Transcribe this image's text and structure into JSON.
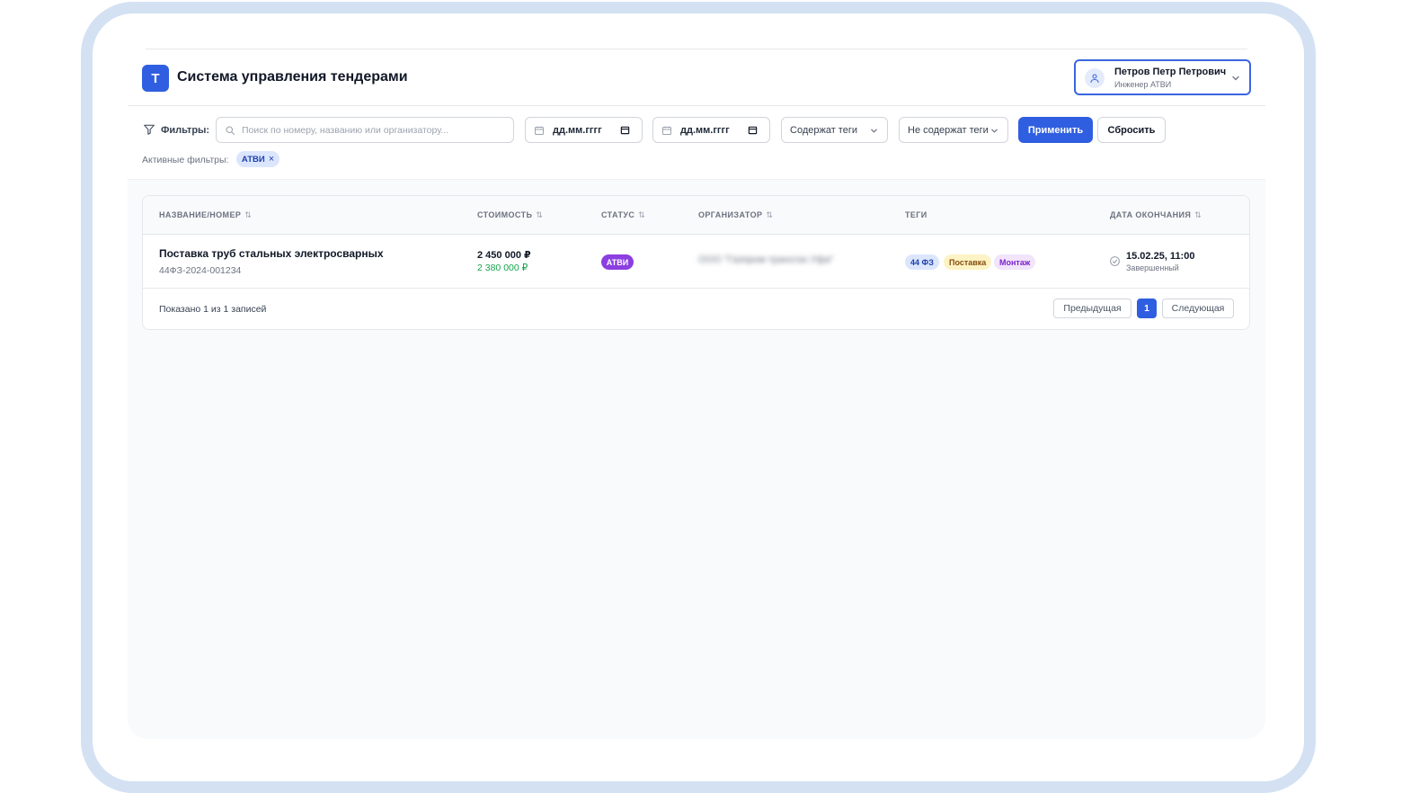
{
  "app": {
    "logo_letter": "Т",
    "title": "Система управления тендерами"
  },
  "user": {
    "name": "Петров Петр Петрович",
    "role": "Инженер АТВИ"
  },
  "filters": {
    "label": "Фильтры:",
    "search_placeholder": "Поиск по номеру, названию или организатору...",
    "date_from": "дд.мм.гггг",
    "date_to": "дд.мм.гггг",
    "tags_include": "Содержат теги",
    "tags_exclude": "Не содержат теги",
    "apply_label": "Применить",
    "reset_label": "Сбросить",
    "active_label": "Активные фильтры:",
    "active_chip": "АТВИ",
    "chip_remove": "×"
  },
  "table": {
    "columns": {
      "name": "НАЗВАНИЕ/НОМЕР",
      "cost": "СТОИМОСТЬ",
      "status": "СТАТУС",
      "organizer": "ОРГАНИЗАТОР",
      "tags": "ТЕГИ",
      "end_date": "ДАТА ОКОНЧАНИЯ"
    },
    "sort_glyph": "⇅",
    "rows": [
      {
        "title": "Поставка труб стальных электросварных",
        "number": "44ФЗ-2024-001234",
        "price": "2 450 000 ₽",
        "price_offer": "2 380 000 ₽",
        "status": "АТВИ",
        "organizer": "ООО \"Газпром трансгаз Уфа\"",
        "tags": [
          "44 ФЗ",
          "Поставка",
          "Монтаж"
        ],
        "end_date": "15.02.25, 11:00",
        "end_status": "Завершенный"
      }
    ],
    "summary": "Показано 1 из 1 записей",
    "pagination": {
      "prev": "Предыдущая",
      "current": "1",
      "next": "Следующая"
    }
  },
  "colors": {
    "accent": "#2f5fe0",
    "status_badge": "#8b3fe0",
    "price_offer": "#16a34a"
  }
}
